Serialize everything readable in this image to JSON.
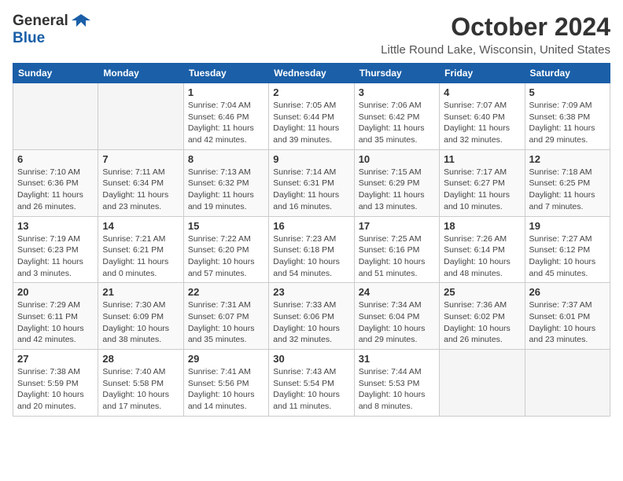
{
  "header": {
    "logo_general": "General",
    "logo_blue": "Blue",
    "title": "October 2024",
    "location": "Little Round Lake, Wisconsin, United States"
  },
  "weekdays": [
    "Sunday",
    "Monday",
    "Tuesday",
    "Wednesday",
    "Thursday",
    "Friday",
    "Saturday"
  ],
  "weeks": [
    [
      {
        "day": "",
        "info": ""
      },
      {
        "day": "",
        "info": ""
      },
      {
        "day": "1",
        "info": "Sunrise: 7:04 AM\nSunset: 6:46 PM\nDaylight: 11 hours and 42 minutes."
      },
      {
        "day": "2",
        "info": "Sunrise: 7:05 AM\nSunset: 6:44 PM\nDaylight: 11 hours and 39 minutes."
      },
      {
        "day": "3",
        "info": "Sunrise: 7:06 AM\nSunset: 6:42 PM\nDaylight: 11 hours and 35 minutes."
      },
      {
        "day": "4",
        "info": "Sunrise: 7:07 AM\nSunset: 6:40 PM\nDaylight: 11 hours and 32 minutes."
      },
      {
        "day": "5",
        "info": "Sunrise: 7:09 AM\nSunset: 6:38 PM\nDaylight: 11 hours and 29 minutes."
      }
    ],
    [
      {
        "day": "6",
        "info": "Sunrise: 7:10 AM\nSunset: 6:36 PM\nDaylight: 11 hours and 26 minutes."
      },
      {
        "day": "7",
        "info": "Sunrise: 7:11 AM\nSunset: 6:34 PM\nDaylight: 11 hours and 23 minutes."
      },
      {
        "day": "8",
        "info": "Sunrise: 7:13 AM\nSunset: 6:32 PM\nDaylight: 11 hours and 19 minutes."
      },
      {
        "day": "9",
        "info": "Sunrise: 7:14 AM\nSunset: 6:31 PM\nDaylight: 11 hours and 16 minutes."
      },
      {
        "day": "10",
        "info": "Sunrise: 7:15 AM\nSunset: 6:29 PM\nDaylight: 11 hours and 13 minutes."
      },
      {
        "day": "11",
        "info": "Sunrise: 7:17 AM\nSunset: 6:27 PM\nDaylight: 11 hours and 10 minutes."
      },
      {
        "day": "12",
        "info": "Sunrise: 7:18 AM\nSunset: 6:25 PM\nDaylight: 11 hours and 7 minutes."
      }
    ],
    [
      {
        "day": "13",
        "info": "Sunrise: 7:19 AM\nSunset: 6:23 PM\nDaylight: 11 hours and 3 minutes."
      },
      {
        "day": "14",
        "info": "Sunrise: 7:21 AM\nSunset: 6:21 PM\nDaylight: 11 hours and 0 minutes."
      },
      {
        "day": "15",
        "info": "Sunrise: 7:22 AM\nSunset: 6:20 PM\nDaylight: 10 hours and 57 minutes."
      },
      {
        "day": "16",
        "info": "Sunrise: 7:23 AM\nSunset: 6:18 PM\nDaylight: 10 hours and 54 minutes."
      },
      {
        "day": "17",
        "info": "Sunrise: 7:25 AM\nSunset: 6:16 PM\nDaylight: 10 hours and 51 minutes."
      },
      {
        "day": "18",
        "info": "Sunrise: 7:26 AM\nSunset: 6:14 PM\nDaylight: 10 hours and 48 minutes."
      },
      {
        "day": "19",
        "info": "Sunrise: 7:27 AM\nSunset: 6:12 PM\nDaylight: 10 hours and 45 minutes."
      }
    ],
    [
      {
        "day": "20",
        "info": "Sunrise: 7:29 AM\nSunset: 6:11 PM\nDaylight: 10 hours and 42 minutes."
      },
      {
        "day": "21",
        "info": "Sunrise: 7:30 AM\nSunset: 6:09 PM\nDaylight: 10 hours and 38 minutes."
      },
      {
        "day": "22",
        "info": "Sunrise: 7:31 AM\nSunset: 6:07 PM\nDaylight: 10 hours and 35 minutes."
      },
      {
        "day": "23",
        "info": "Sunrise: 7:33 AM\nSunset: 6:06 PM\nDaylight: 10 hours and 32 minutes."
      },
      {
        "day": "24",
        "info": "Sunrise: 7:34 AM\nSunset: 6:04 PM\nDaylight: 10 hours and 29 minutes."
      },
      {
        "day": "25",
        "info": "Sunrise: 7:36 AM\nSunset: 6:02 PM\nDaylight: 10 hours and 26 minutes."
      },
      {
        "day": "26",
        "info": "Sunrise: 7:37 AM\nSunset: 6:01 PM\nDaylight: 10 hours and 23 minutes."
      }
    ],
    [
      {
        "day": "27",
        "info": "Sunrise: 7:38 AM\nSunset: 5:59 PM\nDaylight: 10 hours and 20 minutes."
      },
      {
        "day": "28",
        "info": "Sunrise: 7:40 AM\nSunset: 5:58 PM\nDaylight: 10 hours and 17 minutes."
      },
      {
        "day": "29",
        "info": "Sunrise: 7:41 AM\nSunset: 5:56 PM\nDaylight: 10 hours and 14 minutes."
      },
      {
        "day": "30",
        "info": "Sunrise: 7:43 AM\nSunset: 5:54 PM\nDaylight: 10 hours and 11 minutes."
      },
      {
        "day": "31",
        "info": "Sunrise: 7:44 AM\nSunset: 5:53 PM\nDaylight: 10 hours and 8 minutes."
      },
      {
        "day": "",
        "info": ""
      },
      {
        "day": "",
        "info": ""
      }
    ]
  ]
}
